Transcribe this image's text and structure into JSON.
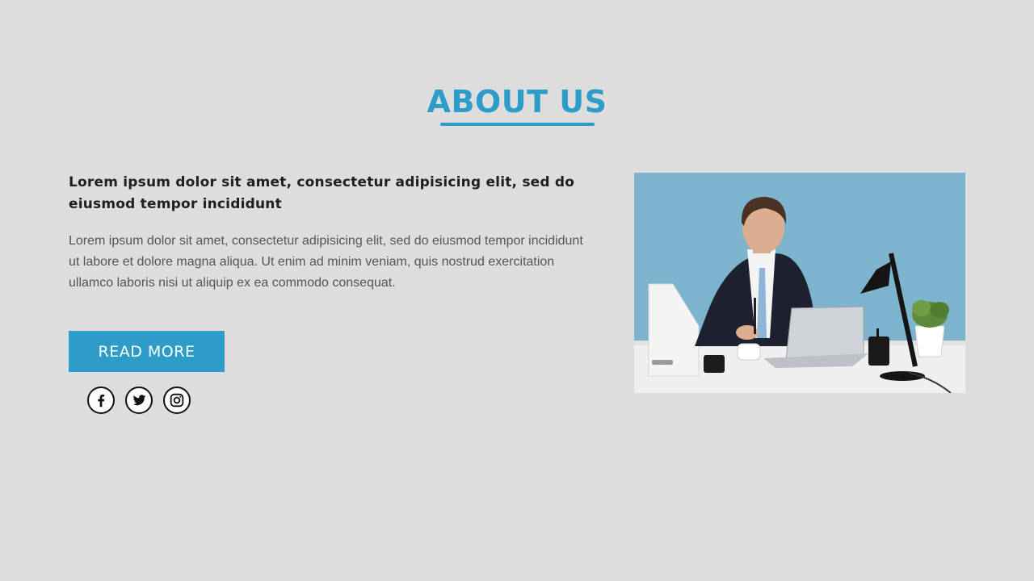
{
  "section": {
    "title": "ABOUT US",
    "lead": "Lorem ipsum dolor sit amet, consectetur adipisicing elit, sed do eiusmod tempor incididunt",
    "body": "Lorem ipsum dolor sit amet, consectetur adipisicing elit, sed do eiusmod tempor incididunt ut labore et dolore magna aliqua. Ut enim ad minim veniam, quis nostrud exercitation ullamco laboris nisi ut aliquip ex ea commodo consequat."
  },
  "cta": {
    "label": "READ MORE"
  },
  "socials": [
    {
      "icon": "facebook-icon"
    },
    {
      "icon": "twitter-icon"
    },
    {
      "icon": "instagram-icon"
    }
  ],
  "colors": {
    "accent": "#2e9cc8",
    "background": "#dddddd",
    "heading_text": "#1f1f1f",
    "body_text": "#555555"
  }
}
